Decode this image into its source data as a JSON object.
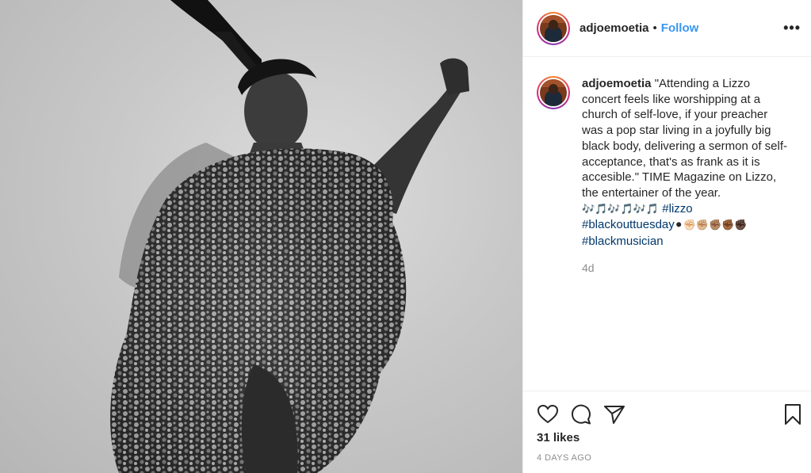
{
  "post": {
    "author": "adjoemoetia",
    "separator": "•",
    "follow_label": "Follow",
    "more_label": "•••",
    "caption": {
      "username": "adjoemoetia",
      "text": "\"Attending a Lizzo concert feels like worshipping at a church of self-love, if your preacher was a pop star living in a joyfully big black body, delivering a sermon of self-acceptance, that's as frank as it is accesible.\" TIME Magazine on Lizzo, the entertainer of the year.",
      "music_notes": "🎶🎵🎶🎵🎶🎵",
      "hashtags": [
        "#lizzo",
        "#blackouttuesday",
        "#blackmusician"
      ],
      "fist_emojis": "⚫✊🏻✊🏼✊🏽✊🏾✊🏿"
    },
    "age": "4d",
    "likes": "31 likes",
    "date": "4 DAYS AGO"
  },
  "icons": {
    "like": "heart-icon",
    "comment": "comment-icon",
    "share": "paper-plane-icon",
    "save": "bookmark-icon",
    "more": "ellipsis-icon"
  },
  "colors": {
    "follow": "#3897f0",
    "hashtag": "#00376b",
    "muted": "#8e8e8e"
  }
}
